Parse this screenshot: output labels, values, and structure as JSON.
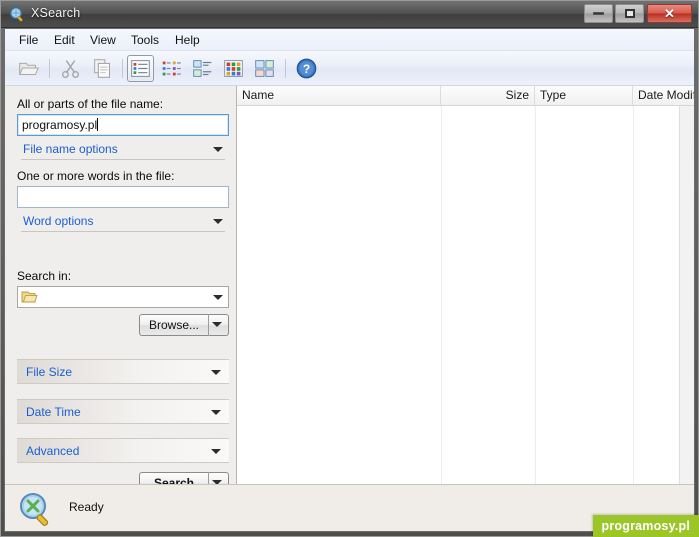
{
  "window": {
    "title": "XSearch",
    "title_icon": "magnifier-icon",
    "controls": {
      "minimize": "–",
      "maximize": "□",
      "close": "✕"
    }
  },
  "menubar": {
    "items": [
      {
        "label": "File"
      },
      {
        "label": "Edit"
      },
      {
        "label": "View"
      },
      {
        "label": "Tools"
      },
      {
        "label": "Help"
      }
    ]
  },
  "toolbar": {
    "buttons": [
      {
        "name": "open-folder-icon",
        "enabled": false
      },
      {
        "name": "cut-icon",
        "enabled": false
      },
      {
        "name": "copy-icon",
        "enabled": false
      },
      {
        "name": "view-details-icon",
        "active": true
      },
      {
        "name": "view-list-icon",
        "active": false
      },
      {
        "name": "view-tiles-icon",
        "active": false
      },
      {
        "name": "view-small-icons-icon",
        "active": false
      },
      {
        "name": "view-large-icons-icon",
        "active": false
      },
      {
        "name": "help-icon",
        "active": false
      }
    ]
  },
  "search_panel": {
    "filename_label": "All or parts of the file name:",
    "filename_value": "programosy.pl",
    "filename_options_label": "File name options",
    "words_label": "One or more words in the file:",
    "words_value": "",
    "word_options_label": "Word options",
    "search_in_label": "Search in:",
    "search_in_value": "",
    "browse_label": "Browse...",
    "sections": [
      {
        "label": "File Size"
      },
      {
        "label": "Date Time"
      },
      {
        "label": "Advanced"
      }
    ],
    "search_button_label": "Search"
  },
  "results": {
    "columns": [
      {
        "label": "Name",
        "align": "left"
      },
      {
        "label": "Size",
        "align": "right"
      },
      {
        "label": "Type",
        "align": "left"
      },
      {
        "label": "Date Modif",
        "align": "left"
      }
    ],
    "rows": []
  },
  "statusbar": {
    "icon": "magnifier-icon",
    "text": "Ready"
  },
  "watermark": {
    "label": "programosy.pl",
    "color": "#9cc528"
  }
}
